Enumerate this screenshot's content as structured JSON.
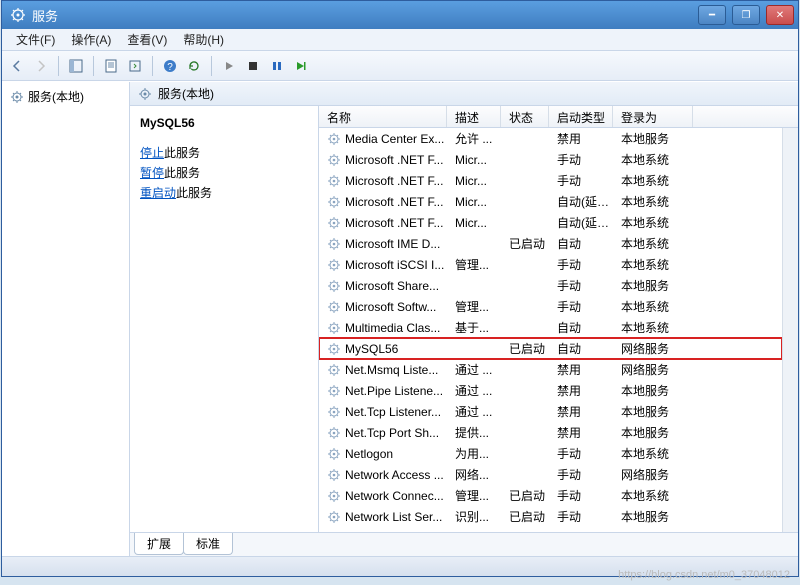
{
  "window": {
    "title": "服务"
  },
  "menubar": {
    "file": "文件(F)",
    "action": "操作(A)",
    "view": "查看(V)",
    "help": "帮助(H)"
  },
  "tree": {
    "root": "服务(本地)"
  },
  "right_header": {
    "label": "服务(本地)"
  },
  "detail": {
    "selected_name": "MySQL56",
    "stop_link": "停止",
    "stop_suffix": "此服务",
    "pause_link": "暂停",
    "pause_suffix": "此服务",
    "restart_link": "重启动",
    "restart_suffix": "此服务"
  },
  "columns": {
    "name": "名称",
    "desc": "描述",
    "state": "状态",
    "start": "启动类型",
    "logon": "登录为"
  },
  "services": [
    {
      "name": "Media Center Ex...",
      "desc": "允许 ...",
      "state": "",
      "start": "禁用",
      "logon": "本地服务"
    },
    {
      "name": "Microsoft .NET F...",
      "desc": "Micr...",
      "state": "",
      "start": "手动",
      "logon": "本地系统"
    },
    {
      "name": "Microsoft .NET F...",
      "desc": "Micr...",
      "state": "",
      "start": "手动",
      "logon": "本地系统"
    },
    {
      "name": "Microsoft .NET F...",
      "desc": "Micr...",
      "state": "",
      "start": "自动(延迟...",
      "logon": "本地系统"
    },
    {
      "name": "Microsoft .NET F...",
      "desc": "Micr...",
      "state": "",
      "start": "自动(延迟...",
      "logon": "本地系统"
    },
    {
      "name": "Microsoft IME D...",
      "desc": "",
      "state": "已启动",
      "start": "自动",
      "logon": "本地系统"
    },
    {
      "name": "Microsoft iSCSI I...",
      "desc": "管理...",
      "state": "",
      "start": "手动",
      "logon": "本地系统"
    },
    {
      "name": "Microsoft Share...",
      "desc": "",
      "state": "",
      "start": "手动",
      "logon": "本地服务"
    },
    {
      "name": "Microsoft Softw...",
      "desc": "管理...",
      "state": "",
      "start": "手动",
      "logon": "本地系统"
    },
    {
      "name": "Multimedia Clas...",
      "desc": "基于...",
      "state": "",
      "start": "自动",
      "logon": "本地系统"
    },
    {
      "name": "MySQL56",
      "desc": "",
      "state": "已启动",
      "start": "自动",
      "logon": "网络服务",
      "highlight": true
    },
    {
      "name": "Net.Msmq Liste...",
      "desc": "通过 ...",
      "state": "",
      "start": "禁用",
      "logon": "网络服务"
    },
    {
      "name": "Net.Pipe Listene...",
      "desc": "通过 ...",
      "state": "",
      "start": "禁用",
      "logon": "本地服务"
    },
    {
      "name": "Net.Tcp Listener...",
      "desc": "通过 ...",
      "state": "",
      "start": "禁用",
      "logon": "本地服务"
    },
    {
      "name": "Net.Tcp Port Sh...",
      "desc": "提供...",
      "state": "",
      "start": "禁用",
      "logon": "本地服务"
    },
    {
      "name": "Netlogon",
      "desc": "为用...",
      "state": "",
      "start": "手动",
      "logon": "本地系统"
    },
    {
      "name": "Network Access ...",
      "desc": "网络...",
      "state": "",
      "start": "手动",
      "logon": "网络服务"
    },
    {
      "name": "Network Connec...",
      "desc": "管理...",
      "state": "已启动",
      "start": "手动",
      "logon": "本地系统"
    },
    {
      "name": "Network List Ser...",
      "desc": "识别...",
      "state": "已启动",
      "start": "手动",
      "logon": "本地服务"
    }
  ],
  "tabs": {
    "ext": "扩展",
    "std": "标准"
  },
  "watermark": "https://blog.csdn.net/m0_37048012"
}
